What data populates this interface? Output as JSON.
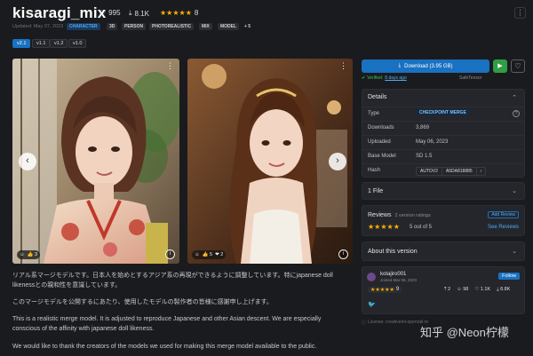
{
  "header": {
    "title": "kisaragi_mix",
    "likes": "995",
    "downloads": "8.1K",
    "rating_stars": "★★★★★",
    "rating_count": "8",
    "updated": "Updated: May 07, 2023",
    "tags": [
      "CHARACTER",
      "3D",
      "PERSON",
      "PHOTOREALISTIC",
      "MIX",
      "MODEL",
      "+ 5"
    ],
    "menu_icon": "⋮"
  },
  "versions": [
    "v2.1",
    "v1.1",
    "v1.2",
    "v1.0"
  ],
  "gallery": {
    "left": {
      "reactions": [
        "☺",
        "👍 3"
      ]
    },
    "right": {
      "reactions": [
        "☺",
        "👍 5",
        "❤ 2"
      ]
    },
    "prev": "‹",
    "next": "›"
  },
  "description": {
    "p1": "リアル系マージモデルです。日本人を始めとするアジア系の再現ができるように調整しています。特にjapanese doll",
    "p1b": "likenessとの親和性を意識しています。",
    "p2": "このマージモデルを公開するにあたり、使用したモデルの製作者の皆様に感謝申し上げます。",
    "p3": "This is a realistic merge model. It is adjusted to reproduce Japanese and other Asian descent. We are especially",
    "p3b": "conscious of the affinity with japanese doll likeness.",
    "p4": "We would like to thank the creators of the models we used for making this merge model available to the public."
  },
  "sidebar": {
    "download_label": "Download (3.95 GB)",
    "verified_text": "Verified:",
    "verified_date": "8 days ago",
    "format": "SafeTensor",
    "details": {
      "title": "Details",
      "rows": [
        {
          "key": "Type",
          "value": "CHECKPOINT MERGE"
        },
        {
          "key": "Downloads",
          "value": "3,869"
        },
        {
          "key": "Uploaded",
          "value": "May 06, 2023"
        },
        {
          "key": "Base Model",
          "value": "SD 1.5"
        },
        {
          "key": "Hash",
          "value": "AUTOV2",
          "value2": "A5DA818885"
        }
      ]
    },
    "files": "1 File",
    "reviews": {
      "title": "Reviews",
      "count": "2 version ratings",
      "add": "Add Review",
      "stars": "★★★★★",
      "score": "5 out of 5",
      "see": "See Reviews"
    },
    "about": "About this version",
    "creator": {
      "name": "kotajiro001",
      "joined": "Joined Mar 06, 2023",
      "follow": "Follow",
      "rating": "★★★★★",
      "rating_count": "9",
      "stats": [
        "2",
        "98",
        "1.1K",
        "8.8K"
      ]
    },
    "license": "License: creativeml-openrail-m"
  },
  "watermark": "知乎 @Neon柠檬",
  "colors": {
    "accent": "#1971c2",
    "star": "#fab005",
    "green": "#2f9e44",
    "bg": "#1a1b1e"
  }
}
